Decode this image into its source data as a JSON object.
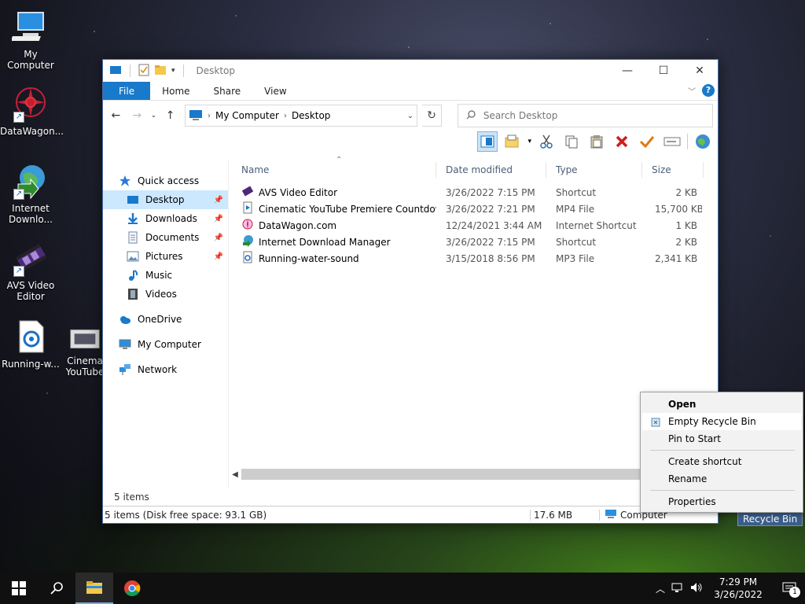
{
  "desktop": {
    "icons": [
      {
        "label": "My Computer"
      },
      {
        "label": "DataWagon..."
      },
      {
        "label": "Internet Downlo..."
      },
      {
        "label": "AVS Video Editor"
      },
      {
        "label": "Running-w..."
      },
      {
        "label": "Cinema YouTube"
      }
    ],
    "recycle_bin_label": "Recycle Bin"
  },
  "window": {
    "title": "Desktop",
    "ribbon_tabs": [
      "File",
      "Home",
      "Share",
      "View"
    ],
    "help": "?",
    "address": {
      "root": "My Computer",
      "current": "Desktop"
    },
    "search_placeholder": "Search Desktop",
    "nav": {
      "quick_access": "Quick access",
      "items": [
        "Desktop",
        "Downloads",
        "Documents",
        "Pictures",
        "Music",
        "Videos"
      ],
      "onedrive": "OneDrive",
      "my_computer": "My Computer",
      "network": "Network"
    },
    "columns": [
      "Name",
      "Date modified",
      "Type",
      "Size"
    ],
    "files": [
      {
        "name": "AVS Video Editor",
        "date": "3/26/2022 7:15 PM",
        "type": "Shortcut",
        "size": "2 KB"
      },
      {
        "name": "Cinematic YouTube Premiere Countdow...",
        "date": "3/26/2022 7:21 PM",
        "type": "MP4 File",
        "size": "15,700 KB"
      },
      {
        "name": "DataWagon.com",
        "date": "12/24/2021 3:44 AM",
        "type": "Internet Shortcut",
        "size": "1 KB"
      },
      {
        "name": "Internet Download Manager",
        "date": "3/26/2022 7:15 PM",
        "type": "Shortcut",
        "size": "2 KB"
      },
      {
        "name": "Running-water-sound",
        "date": "3/15/2018 8:56 PM",
        "type": "MP3 File",
        "size": "2,341 KB"
      }
    ],
    "item_count": "5 items",
    "status": {
      "left": "5 items (Disk free space: 93.1 GB)",
      "size": "17.6 MB",
      "location": "Computer"
    }
  },
  "context_menu": {
    "items": [
      "Open",
      "Empty Recycle Bin",
      "Pin to Start",
      "Create shortcut",
      "Rename",
      "Properties"
    ]
  },
  "taskbar": {
    "time": "7:29 PM",
    "date": "3/26/2022",
    "notification_count": "1"
  },
  "colors": {
    "accent": "#1979ca",
    "selection": "#cce8ff",
    "taskbar": "#101010"
  }
}
